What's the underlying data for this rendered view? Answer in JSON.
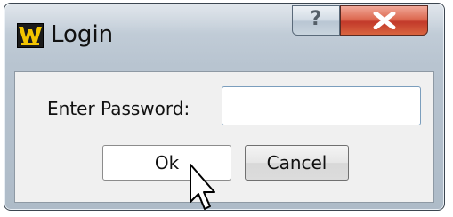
{
  "window": {
    "title": "Login",
    "help_label": "?",
    "app_icon": "w-logo-icon",
    "close_icon": "close-icon"
  },
  "form": {
    "password_label": "Enter Password:",
    "password_value": "",
    "ok_label": "Ok",
    "cancel_label": "Cancel"
  },
  "colors": {
    "close_button": "#c2392a",
    "logo_letter": "#f2c400",
    "logo_background": "#1a1a1a"
  }
}
